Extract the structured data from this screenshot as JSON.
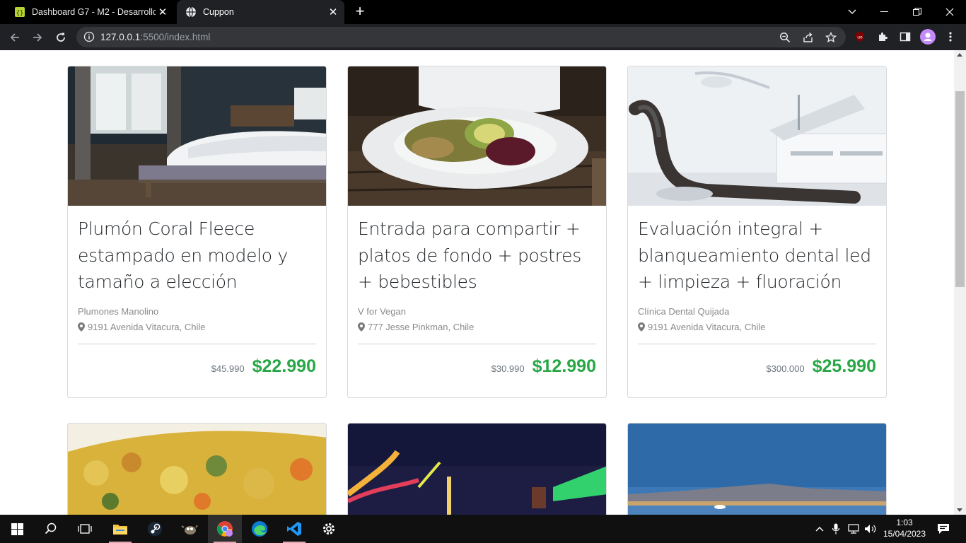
{
  "browser": {
    "tabs": [
      {
        "title": "Dashboard G7 - M2 - Desarrollo",
        "active": false,
        "favicon": "dashboard-favicon"
      },
      {
        "title": "Cuppon",
        "active": true,
        "favicon": "globe-icon"
      }
    ],
    "address": {
      "host": "127.0.0.1",
      "path": ":5500/index.html"
    }
  },
  "cards": [
    {
      "title": "Plumón Coral Fleece estampado en modelo y tamaño a elección",
      "merchant": "Plumones Manolino",
      "address": "9191 Avenida Vitacura, Chile",
      "old_price": "$45.990",
      "price": "$22.990",
      "image": "bedroom-photo"
    },
    {
      "title": "Entrada para compartir + platos de fondo + postres + bebestibles",
      "merchant": "V for Vegan",
      "address": "777 Jesse Pinkman, Chile",
      "old_price": "$30.990",
      "price": "$12.990",
      "image": "salad-plate-photo"
    },
    {
      "title": "Evaluación integral + blanqueamiento dental led + limpieza + fluoración",
      "merchant": "Clínica Dental Quijada",
      "address": "9191 Avenida Vitacura, Chile",
      "old_price": "$300.000",
      "price": "$25.990",
      "image": "dental-chair-photo"
    },
    {
      "image": "curry-food-photo"
    },
    {
      "image": "amusement-park-night-photo"
    },
    {
      "image": "lake-mountain-photo"
    }
  ],
  "colors": {
    "price_green": "#28a745",
    "tab_bar": "#000000",
    "toolbar": "#202124"
  },
  "taskbar": {
    "apps": [
      "windows-start-icon",
      "search-icon",
      "task-view-icon",
      "file-explorer-icon",
      "steam-icon",
      "gimp-icon",
      "chrome-icon",
      "edge-icon",
      "vscode-icon",
      "settings-icon"
    ],
    "clock": {
      "time": "1:03",
      "date": "15/04/2023"
    }
  }
}
